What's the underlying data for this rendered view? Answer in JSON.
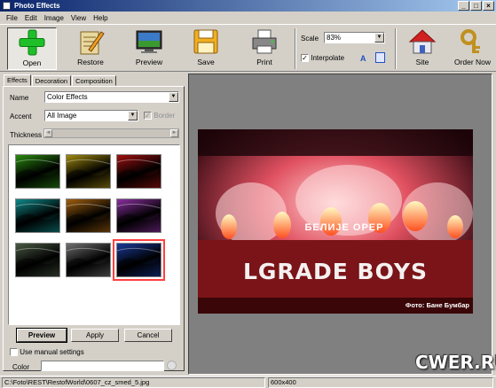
{
  "window": {
    "title": "Photo Effects",
    "controls": [
      "_",
      "□",
      "×"
    ]
  },
  "menu": [
    "File",
    "Edit",
    "Image",
    "View",
    "Help"
  ],
  "toolbar": {
    "open": "Open",
    "restore": "Restore",
    "preview": "Preview",
    "save": "Save",
    "print": "Print",
    "scale_label": "Scale",
    "scale_value": "83%",
    "interpolate_label": "Interpolate",
    "site": "Site",
    "order": "Order Now"
  },
  "tabs": [
    "Effects",
    "Decoration",
    "Composition"
  ],
  "effects": {
    "name_label": "Name",
    "name_value": "Color Effects",
    "accent_label": "Accent",
    "accent_value": "All Image",
    "border_label": "Border",
    "thickness_label": "Thickness"
  },
  "thumbnails": [
    {
      "name": "green",
      "color": "#2a8a10"
    },
    {
      "name": "yellow",
      "color": "#a08a10"
    },
    {
      "name": "red",
      "color": "#a01010"
    },
    {
      "name": "cyan",
      "color": "#108a8a"
    },
    {
      "name": "orange",
      "color": "#a06010"
    },
    {
      "name": "purple",
      "color": "#8a30a0"
    },
    {
      "name": "grayscale-green",
      "color": "#4a5a44"
    },
    {
      "name": "grayscale",
      "color": "#707070"
    },
    {
      "name": "blue",
      "color": "#1a3a9a"
    }
  ],
  "buttons": {
    "preview": "Preview",
    "apply": "Apply",
    "cancel": "Cancel"
  },
  "manual": {
    "label": "Use manual settings",
    "color_label": "Color"
  },
  "photo": {
    "banner_text": "LGRADE BOYS",
    "sub_text": "БЕЛИЈЕ  ОРЕР",
    "credit": "Фото: Бане Бумбар"
  },
  "status": {
    "path": "C:\\Foto\\REST\\RestofWorld\\0607_cz_smed_5.jpg",
    "size": "600x400"
  },
  "watermark": "CWER.RU"
}
